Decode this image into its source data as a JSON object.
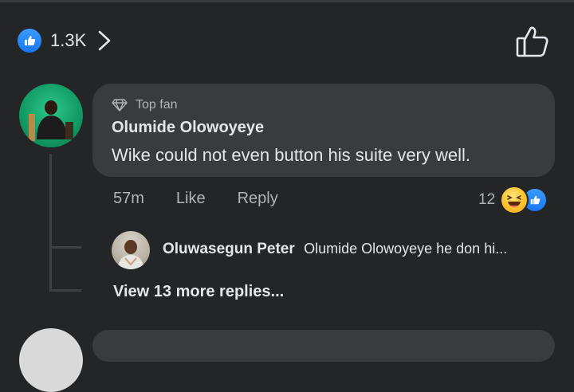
{
  "reactions": {
    "count": "1.3K"
  },
  "comment": {
    "badge": "Top fan",
    "author": "Olumide Olowoyeye",
    "text": "Wike could not even button his suite very well.",
    "time": "57m",
    "like_label": "Like",
    "reply_label": "Reply",
    "reaction_count": "12"
  },
  "reply": {
    "author": "Oluwasegun Peter",
    "snippet": "Olumide Olowoyeye he don hi..."
  },
  "view_more": "View 13 more replies...",
  "colors": {
    "background": "#242526",
    "bubble": "#3a3b3c",
    "like_blue": "#1877f2",
    "haha_yellow": "#f9c22b"
  }
}
